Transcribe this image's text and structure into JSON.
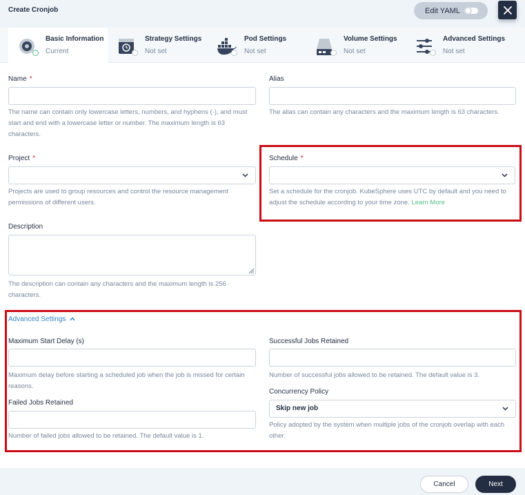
{
  "header": {
    "title": "Create Cronjob",
    "edit_yaml_label": "Edit YAML"
  },
  "tabs": [
    {
      "name": "Basic Information",
      "status": "Current",
      "icon": "basic-info-icon"
    },
    {
      "name": "Strategy Settings",
      "status": "Not set",
      "icon": "strategy-icon"
    },
    {
      "name": "Pod Settings",
      "status": "Not set",
      "icon": "docker-icon"
    },
    {
      "name": "Volume Settings",
      "status": "Not set",
      "icon": "volume-icon"
    },
    {
      "name": "Advanced Settings",
      "status": "Not set",
      "icon": "sliders-icon"
    }
  ],
  "form": {
    "name": {
      "label": "Name",
      "required": "*",
      "value": "",
      "help": "The name can contain only lowercase letters, numbers, and hyphens (-), and must start and end with a lowercase letter or number. The maximum length is 63 characters."
    },
    "alias": {
      "label": "Alias",
      "value": "",
      "help": "The alias can contain any characters and the maximum length is 63 characters."
    },
    "project": {
      "label": "Project",
      "required": "*",
      "value": "",
      "help": "Projects are used to group resources and control the resource management permissions of different users."
    },
    "schedule": {
      "label": "Schedule",
      "required": "*",
      "value": "",
      "help": "Set a schedule for the cronjob. KubeSphere uses UTC by default and you need to adjust the schedule according to your time zone.",
      "help_link": "Learn More"
    },
    "description": {
      "label": "Description",
      "value": "",
      "help": "The description can contain any characters and the maximum length is 256 characters."
    }
  },
  "advanced": {
    "toggle_label": "Advanced Settings",
    "max_start_delay": {
      "label": "Maximum Start Delay (s)",
      "value": "",
      "help": "Maximum delay before starting a scheduled job when the job is missed for certain reasons."
    },
    "successful_jobs": {
      "label": "Successful Jobs Retained",
      "value": "",
      "help": "Number of successful jobs allowed to be retained. The default value is 3."
    },
    "failed_jobs": {
      "label": "Failed Jobs Retained",
      "value": "",
      "help": "Number of failed jobs allowed to be retained. The default value is 1."
    },
    "concurrency": {
      "label": "Concurrency Policy",
      "value": "Skip new job",
      "help": "Policy adopted by the system when multiple jobs of the cronjob overlap with each other."
    }
  },
  "footer": {
    "cancel_label": "Cancel",
    "next_label": "Next"
  },
  "colors": {
    "primary": "#242e42",
    "highlight_box": "#ca0b15",
    "link": "#55bc8a",
    "advanced_toggle": "#3385c6"
  }
}
